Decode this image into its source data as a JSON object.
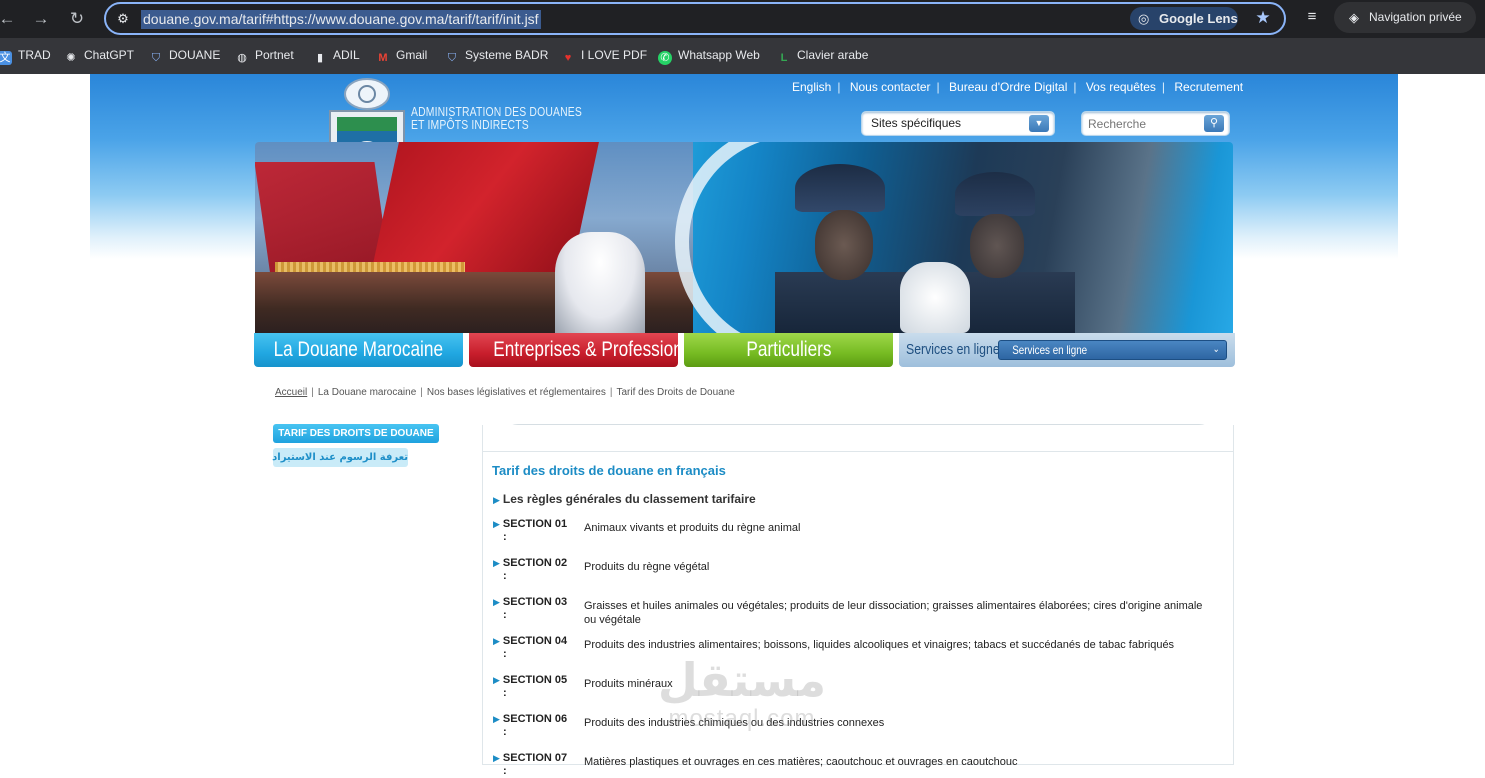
{
  "browser": {
    "back_icon": "back-arrow-icon",
    "forward_icon": "forward-arrow-icon",
    "reload_icon": "reload-icon",
    "url": "douane.gov.ma/tarif#https://www.douane.gov.ma/tarif/tarif/init.jsf",
    "lens_label": "Google Lens",
    "incognito_label": "Navigation privée"
  },
  "bookmarks": [
    {
      "label": "TRAD",
      "icon": "translate-icon",
      "color": "#4a90e2"
    },
    {
      "label": "ChatGPT",
      "icon": "chatgpt-icon",
      "color": "#202124"
    },
    {
      "label": "DOUANE",
      "icon": "shield-icon",
      "color": "#8ab4f8"
    },
    {
      "label": "Portnet",
      "icon": "globe-icon",
      "color": "#e8eaed"
    },
    {
      "label": "ADIL",
      "icon": "page-icon",
      "color": "#e8eaed"
    },
    {
      "label": "Gmail",
      "icon": "gmail-icon",
      "color": "#ea4335"
    },
    {
      "label": "Systeme BADR",
      "icon": "shield-icon",
      "color": "#8ab4f8"
    },
    {
      "label": "I LOVE PDF",
      "icon": "heart-icon",
      "color": "#e5322d"
    },
    {
      "label": "Whatsapp Web",
      "icon": "whatsapp-icon",
      "color": "#25d366"
    },
    {
      "label": "Clavier arabe",
      "icon": "keyboard-icon",
      "color": "#34a853"
    }
  ],
  "header": {
    "top_links": [
      "English",
      "Nous contacter",
      "Bureau d'Ordre Digital",
      "Vos requêtes",
      "Recrutement"
    ],
    "logo_text_line1": "ADMINISTRATION DES DOUANES",
    "logo_text_line2": "ET IMPÔTS INDIRECTS",
    "sites_select": "Sites spécifiques",
    "search_placeholder": "Recherche"
  },
  "nav": {
    "tabs": [
      "La Douane Marocaine",
      "Entreprises & Professionnels",
      "Particuliers"
    ],
    "services_label": "Services en ligne",
    "services_select": "Services en ligne"
  },
  "breadcrumb": [
    "Accueil",
    "La Douane marocaine",
    "Nos bases législatives et réglementaires",
    "Tarif des Droits de Douane"
  ],
  "sidebar": {
    "btn_fr": "TARIF DES DROITS DE DOUANE",
    "btn_ar": "تعرفة الرسوم عند الاستيراد"
  },
  "content": {
    "title": "Tarif des droits de douane en français",
    "rules_link": "Les règles générales du classement tarifaire",
    "sections": [
      {
        "label": "SECTION 01",
        "desc": "Animaux vivants et produits du règne animal"
      },
      {
        "label": "SECTION 02",
        "desc": "Produits du règne végétal"
      },
      {
        "label": "SECTION 03",
        "desc": "Graisses et huiles animales ou végétales; produits de leur dissociation; graisses alimentaires élaborées; cires d'origine animale ou végétale"
      },
      {
        "label": "SECTION 04",
        "desc": "Produits des industries alimentaires; boissons, liquides alcooliques et vinaigres; tabacs et succédanés de tabac fabriqués"
      },
      {
        "label": "SECTION 05",
        "desc": "Produits minéraux"
      },
      {
        "label": "SECTION 06",
        "desc": "Produits des industries chimiques ou des industries connexes"
      },
      {
        "label": "SECTION 07",
        "desc": "Matières plastiques et ouvrages en ces matières; caoutchouc et ouvrages en caoutchouc"
      }
    ],
    "colon": ":"
  },
  "watermark": {
    "arabic": "مستقل",
    "latin": "mostaql.com"
  }
}
